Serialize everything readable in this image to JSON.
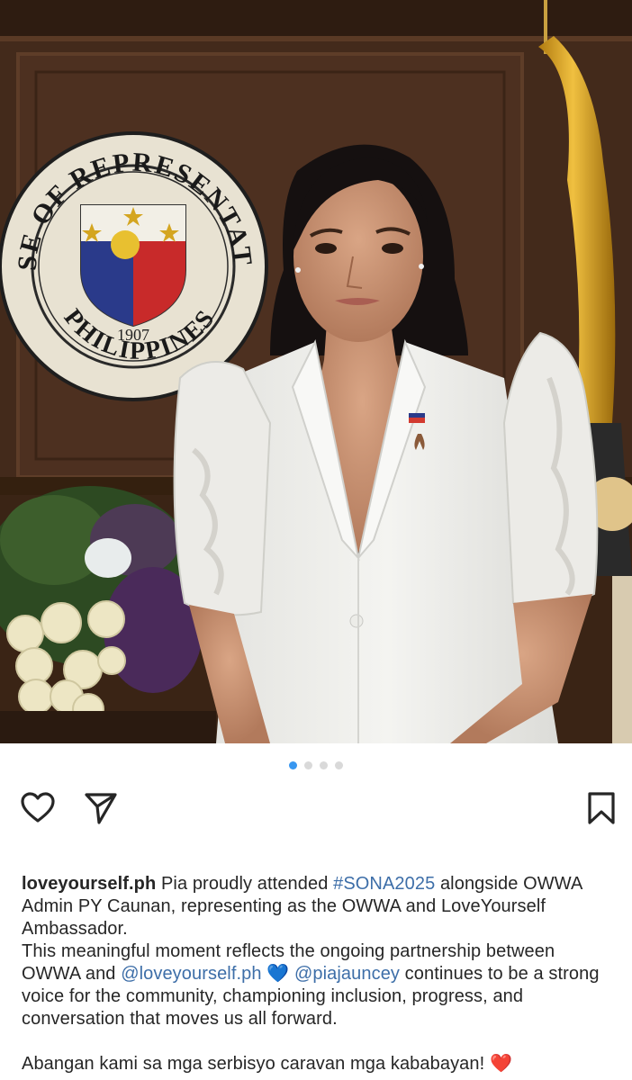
{
  "post": {
    "seal": {
      "arc_top": "HOUSE OF REPRESENTATIVES",
      "arc_bottom": "PHILIPPINES",
      "year": "1907"
    },
    "carousel": {
      "count": 4,
      "active_index": 0
    },
    "actions": {
      "like_icon": "heart-outline-icon",
      "share_icon": "paper-plane-icon",
      "save_icon": "bookmark-outline-icon"
    },
    "caption": {
      "username": "loveyourself.ph",
      "line1_text": " Pia proudly attended ",
      "hashtag": "#SONA2025",
      "line1_rest": " alongside OWWA Admin PY Caunan, representing as the OWWA and LoveYourself Ambassador.",
      "p2_text1": "This meaningful moment reflects the ongoing partnership between OWWA and ",
      "mention1": "@loveyourself.ph",
      "blue_heart": "💙",
      "mention2": "@piajauncey",
      "p2_text2": "  continues to be a strong voice for the community, championing inclusion, progress, and conversation that moves us all forward.",
      "p3_text": "Abangan kami sa mga serbisyo caravan mga kababayan! ",
      "red_heart": "❤️"
    }
  },
  "colors": {
    "accent_blue": "#3897f0",
    "mention_blue": "#3d6ea8",
    "text": "#262626"
  }
}
